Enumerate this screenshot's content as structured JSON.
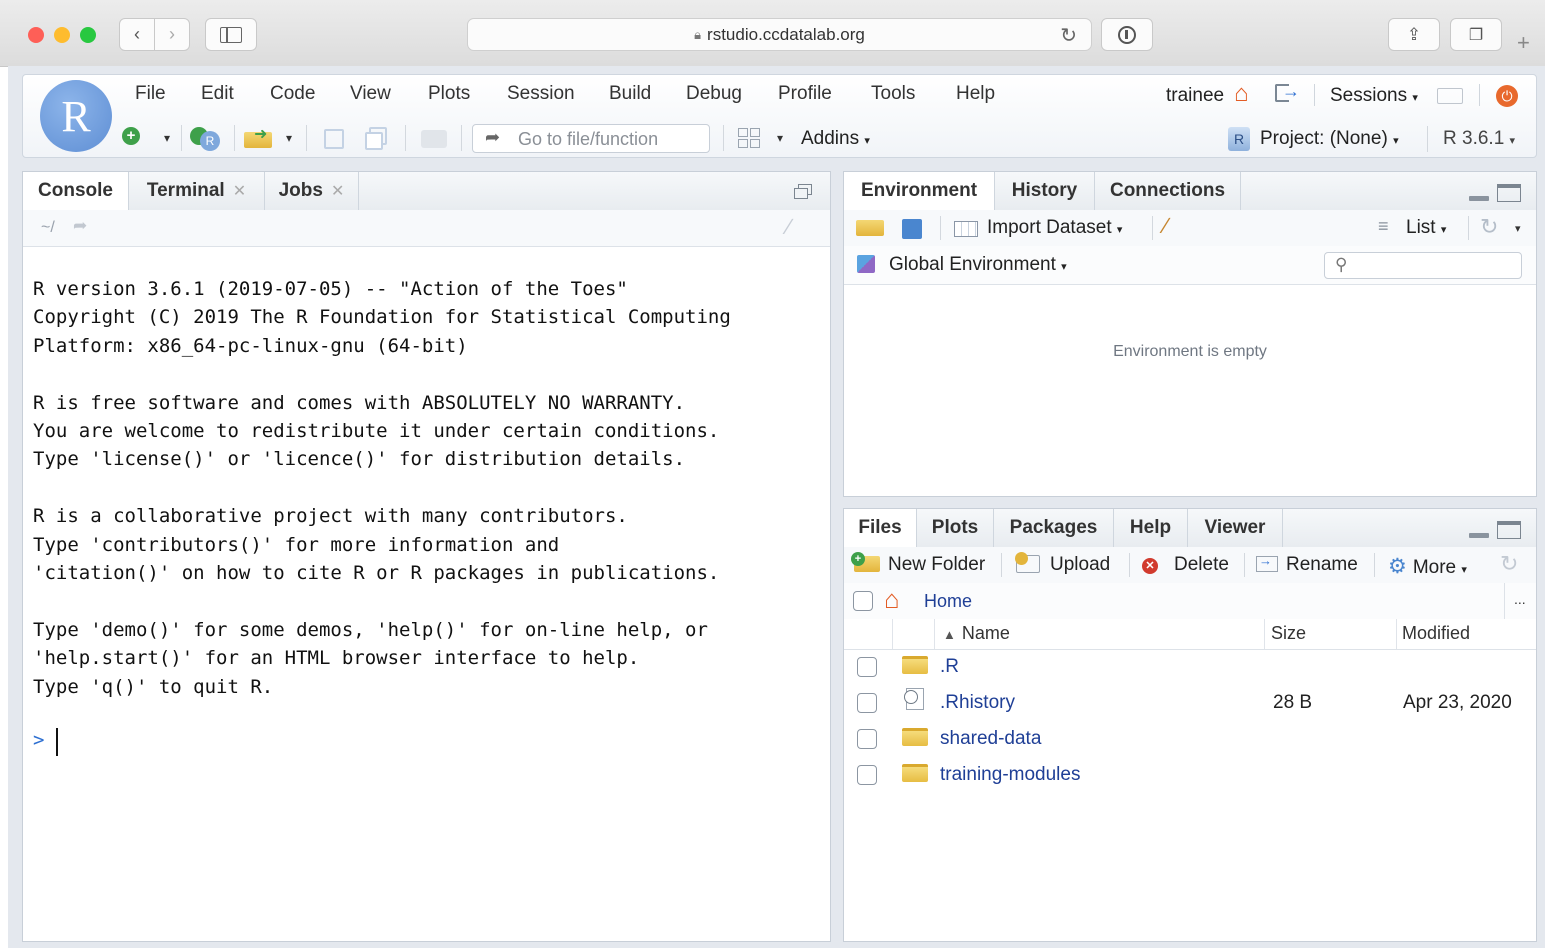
{
  "browser": {
    "url": "rstudio.ccdatalab.org"
  },
  "menu": [
    "File",
    "Edit",
    "Code",
    "View",
    "Plots",
    "Session",
    "Build",
    "Debug",
    "Profile",
    "Tools",
    "Help"
  ],
  "user": {
    "name": "trainee",
    "sessions_label": "Sessions"
  },
  "toolbar": {
    "goto_placeholder": "Go to file/function",
    "addins_label": "Addins",
    "project_label": "Project: (None)",
    "r_version": "R 3.6.1"
  },
  "console_pane": {
    "tabs": [
      "Console",
      "Terminal",
      "Jobs"
    ],
    "path": "~/",
    "lines": [
      "R version 3.6.1 (2019-07-05) -- \"Action of the Toes\"",
      "Copyright (C) 2019 The R Foundation for Statistical Computing",
      "Platform: x86_64-pc-linux-gnu (64-bit)",
      "",
      "R is free software and comes with ABSOLUTELY NO WARRANTY.",
      "You are welcome to redistribute it under certain conditions.",
      "Type 'license()' or 'licence()' for distribution details.",
      "",
      "R is a collaborative project with many contributors.",
      "Type 'contributors()' for more information and",
      "'citation()' on how to cite R or R packages in publications.",
      "",
      "Type 'demo()' for some demos, 'help()' for on-line help, or",
      "'help.start()' for an HTML browser interface to help.",
      "Type 'q()' to quit R."
    ],
    "prompt": ">"
  },
  "env_pane": {
    "tabs": [
      "Environment",
      "History",
      "Connections"
    ],
    "import_label": "Import Dataset",
    "list_label": "List",
    "scope_label": "Global Environment",
    "empty_message": "Environment is empty"
  },
  "files_pane": {
    "tabs": [
      "Files",
      "Plots",
      "Packages",
      "Help",
      "Viewer"
    ],
    "actions": {
      "new_folder": "New Folder",
      "upload": "Upload",
      "delete": "Delete",
      "rename": "Rename",
      "more": "More"
    },
    "breadcrumb": "Home",
    "more_dots": "...",
    "columns": {
      "name": "Name",
      "size": "Size",
      "modified": "Modified"
    },
    "files": [
      {
        "name": ".R",
        "size": "",
        "modified": "",
        "icon": "folder-icon"
      },
      {
        "name": ".Rhistory",
        "size": "28 B",
        "modified": "Apr 23, 2020",
        "icon": "history-file-icon"
      },
      {
        "name": "shared-data",
        "size": "",
        "modified": "",
        "icon": "folder-icon"
      },
      {
        "name": "training-modules",
        "size": "",
        "modified": "",
        "icon": "folder-icon"
      }
    ]
  },
  "colors": {
    "accent": "#2d6fd1",
    "link": "#1f3f96",
    "home": "#e35d25",
    "power": "#e8692d"
  }
}
